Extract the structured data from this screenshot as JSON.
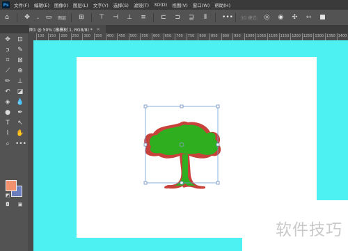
{
  "app": {
    "logo": "Ps"
  },
  "menu": [
    "文件(F)",
    "编辑(E)",
    "图像(I)",
    "图层(L)",
    "文字(Y)",
    "选择(S)",
    "滤镜(T)",
    "3D(D)",
    "视图(V)",
    "窗口(W)",
    "帮助(H)"
  ],
  "options_bar": {
    "auto_select": "图层",
    "mode_3d": "3D 模式:"
  },
  "document_tab": {
    "title": "图1 @ 50% (橡模树 1, RGB/8) *",
    "close": "×"
  },
  "ruler": {
    "marks": [
      "100",
      "150",
      "200",
      "250",
      "300",
      "350",
      "400",
      "450",
      "500",
      "550",
      "600",
      "650",
      "700",
      "750",
      "800",
      "850",
      "900",
      "950",
      "1000",
      "1050",
      "1100",
      "1150",
      "1200",
      "1250",
      "1300",
      "1350",
      "1400",
      "1450",
      "1500",
      "1550",
      "1600",
      "1650",
      "1700",
      "1750",
      "1800"
    ]
  },
  "colors": {
    "foreground": "#f2916e",
    "background": "#6b7fbf",
    "pasteboard": "#4ef1f2",
    "tree_leaves": "#2fae1f",
    "tree_outline": "#c8423c",
    "selection": "#6aa0d8"
  },
  "watermark": "软件技巧",
  "icons": [
    "home-icon",
    "move-icon",
    "align-icon",
    "grid-icon",
    "more-icon",
    "marquee-icon",
    "lasso-icon",
    "crop-icon",
    "eyedropper-icon",
    "brush-icon",
    "stamp-icon",
    "eraser-icon",
    "bucket-icon",
    "pen-icon",
    "type-icon",
    "hand-icon",
    "zoom-icon"
  ]
}
